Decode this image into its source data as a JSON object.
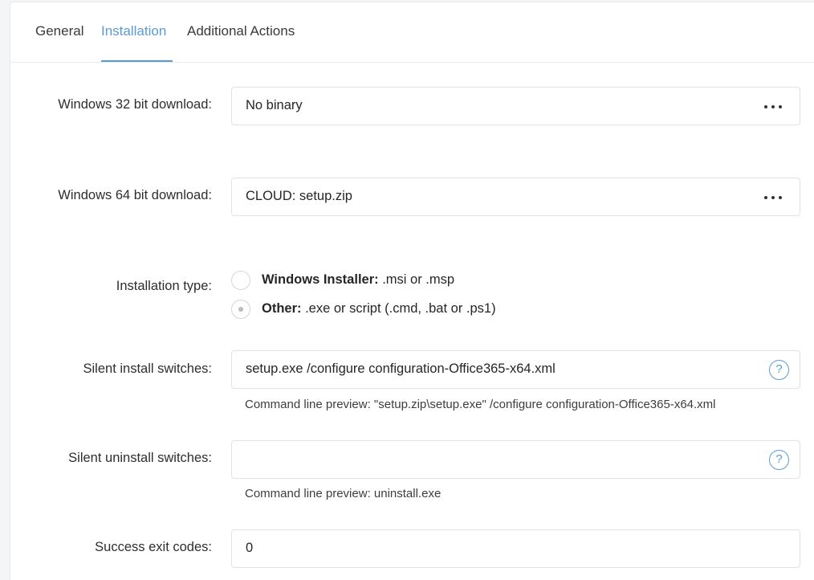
{
  "tabs": [
    {
      "label": "General"
    },
    {
      "label": "Installation"
    },
    {
      "label": "Additional Actions"
    }
  ],
  "active_tab": "Installation",
  "form": {
    "win32": {
      "label": "Windows 32 bit download:",
      "value": "No binary"
    },
    "win64": {
      "label": "Windows 64 bit download:",
      "value": "CLOUD: setup.zip"
    },
    "install_type": {
      "label": "Installation type:",
      "options": [
        {
          "bold": "Windows Installer:",
          "text": " .msi or .msp",
          "selected": false
        },
        {
          "bold": "Other:",
          "text": " .exe or script (.cmd, .bat or .ps1)",
          "selected": true
        }
      ]
    },
    "silent_install": {
      "label": "Silent install switches:",
      "value": "setup.exe /configure configuration-Office365-x64.xml",
      "preview": "Command line preview: \"setup.zip\\setup.exe\"  /configure configuration-Office365-x64.xml"
    },
    "silent_uninstall": {
      "label": "Silent uninstall switches:",
      "value": "",
      "preview": "Command line preview: uninstall.exe"
    },
    "exit_codes": {
      "label": "Success exit codes:",
      "value": "0"
    }
  },
  "icons": {
    "help": "question-circle-icon",
    "more": "ellipsis-icon"
  },
  "colors": {
    "accent": "#5b9bd5",
    "border": "#dfe2e6",
    "background": "#f4f5f7"
  }
}
